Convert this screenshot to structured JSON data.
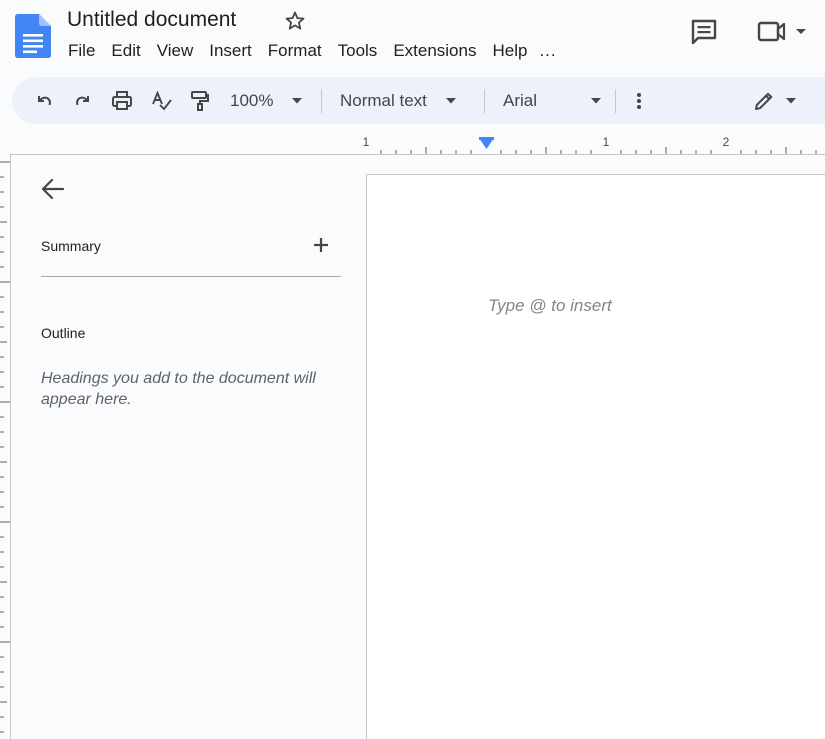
{
  "header": {
    "title": "Untitled document",
    "menu": [
      "File",
      "Edit",
      "View",
      "Insert",
      "Format",
      "Tools",
      "Extensions",
      "Help",
      "..."
    ]
  },
  "toolbar": {
    "zoom": "100%",
    "style": "Normal text",
    "font": "Arial"
  },
  "ruler": {
    "labels": [
      "1",
      "1",
      "2"
    ]
  },
  "sidepanel": {
    "summary_label": "Summary",
    "outline_label": "Outline",
    "outline_hint": "Headings you add to the document will appear here."
  },
  "page": {
    "placeholder": "Type @ to insert"
  },
  "colors": {
    "docs_blue": "#4285f4",
    "toolbar_bg": "#edf2fa",
    "canvas_bg": "#f9fbfd"
  },
  "icons": [
    "docs-logo-icon",
    "star-icon",
    "comment-icon",
    "video-call-icon",
    "undo-icon",
    "redo-icon",
    "print-icon",
    "spellcheck-icon",
    "paint-format-icon",
    "more-vert-icon",
    "edit-pencil-icon",
    "back-arrow-icon",
    "plus-icon"
  ]
}
